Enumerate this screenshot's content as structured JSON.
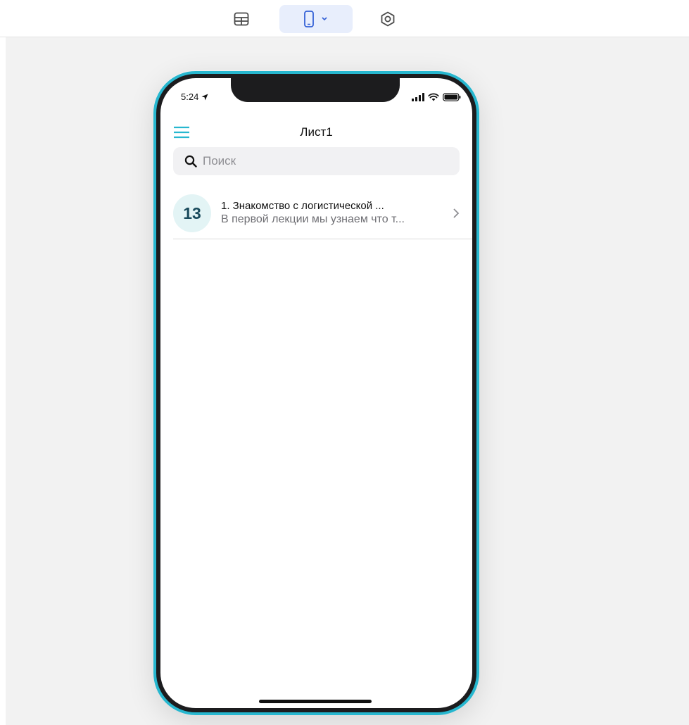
{
  "toolbar": {
    "table_icon": "table-icon",
    "device_icon": "phone-icon",
    "device_chevron_icon": "chevron-down-icon",
    "settings_icon": "settings-icon",
    "active_color": "#e8eefc"
  },
  "phone": {
    "frame_color": "#27b7cf",
    "status": {
      "time": "5:24",
      "location_icon": "location-arrow-icon",
      "icons": [
        "signal-icon",
        "wifi-icon",
        "battery-icon"
      ]
    },
    "navbar": {
      "title": "Лист1",
      "menu_icon": "hamburger-menu-icon"
    },
    "search": {
      "placeholder": "Поиск",
      "value": ""
    },
    "list": [
      {
        "badge": "13",
        "title": "1. Знакомство с логистической ...",
        "subtitle": "В первой лекции мы узнаем что т...",
        "chevron_icon": "chevron-right-icon"
      }
    ]
  }
}
